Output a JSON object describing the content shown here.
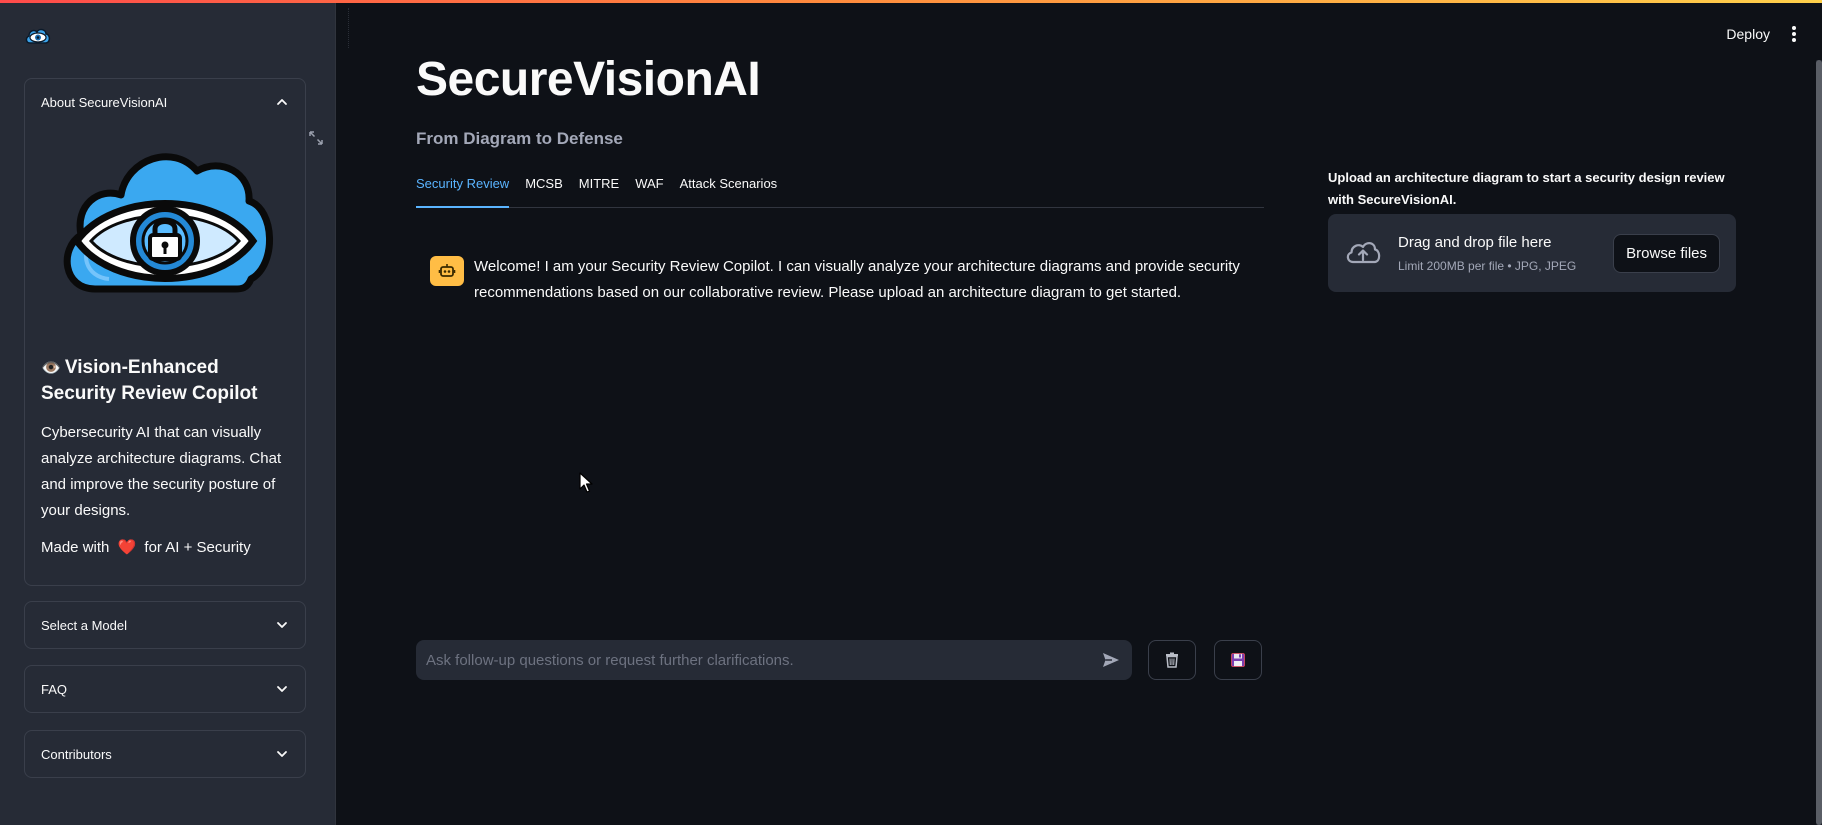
{
  "app": {
    "title": "SecureVisionAI",
    "subtitle": "From Diagram to Defense",
    "deploy_label": "Deploy"
  },
  "sidebar": {
    "about": {
      "label": "About SecureVisionAI",
      "heading": "Vision-Enhanced Security Review Copilot",
      "heading_emoji": "👁️",
      "description": "Cybersecurity AI that can visually analyze architecture diagrams. Chat and improve the security posture of your designs.",
      "made_prefix": "Made with",
      "made_heart": "❤️",
      "made_suffix": "for AI + Security"
    },
    "expanders": [
      {
        "label": "Select a Model"
      },
      {
        "label": "FAQ"
      },
      {
        "label": "Contributors"
      }
    ]
  },
  "tabs": [
    {
      "label": "Security Review",
      "active": true
    },
    {
      "label": "MCSB",
      "active": false
    },
    {
      "label": "MITRE",
      "active": false
    },
    {
      "label": "WAF",
      "active": false
    },
    {
      "label": "Attack Scenarios",
      "active": false
    }
  ],
  "chat": {
    "welcome": "Welcome! I am your Security Review Copilot. I can visually analyze your architecture diagrams and provide security recommendations based on our collaborative review. Please upload an architecture diagram to get started.",
    "input_placeholder": "Ask follow-up questions or request further clarifications."
  },
  "upload": {
    "label": "Upload an architecture diagram to start a security design review with SecureVisionAI.",
    "drop_title": "Drag and drop file here",
    "limit": "Limit 200MB per file • JPG, JPEG",
    "browse_label": "Browse files"
  },
  "icons": {
    "logo": "eye-cloud-icon",
    "send": "send-icon",
    "clear": "trash-icon",
    "save": "save-icon",
    "upload": "cloud-upload-icon",
    "bot": "robot-icon"
  },
  "colors": {
    "background": "#0e1117",
    "sidebar": "#262b36",
    "accent": "#5ab4ff",
    "bot_avatar": "#ffbd45"
  }
}
